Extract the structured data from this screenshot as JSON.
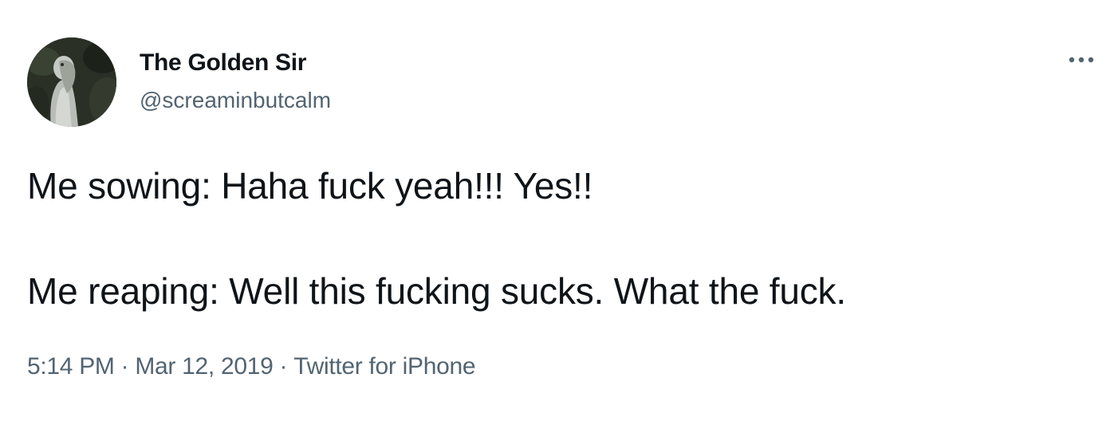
{
  "author": {
    "display_name": "The Golden Sir",
    "handle": "@screaminbutcalm",
    "avatar_icon": "shoebill-bird-avatar"
  },
  "more_icon": "more-options-icon",
  "tweet": {
    "lines": [
      "Me sowing: Haha fuck yeah!!! Yes!!",
      "Me reaping: Well this fucking sucks. What the fuck."
    ]
  },
  "meta": {
    "time": "5:14 PM",
    "separator": "·",
    "date": "Mar 12, 2019",
    "source": "Twitter for iPhone"
  },
  "colors": {
    "text": "#0f1419",
    "secondary": "#536471",
    "background": "#ffffff"
  }
}
